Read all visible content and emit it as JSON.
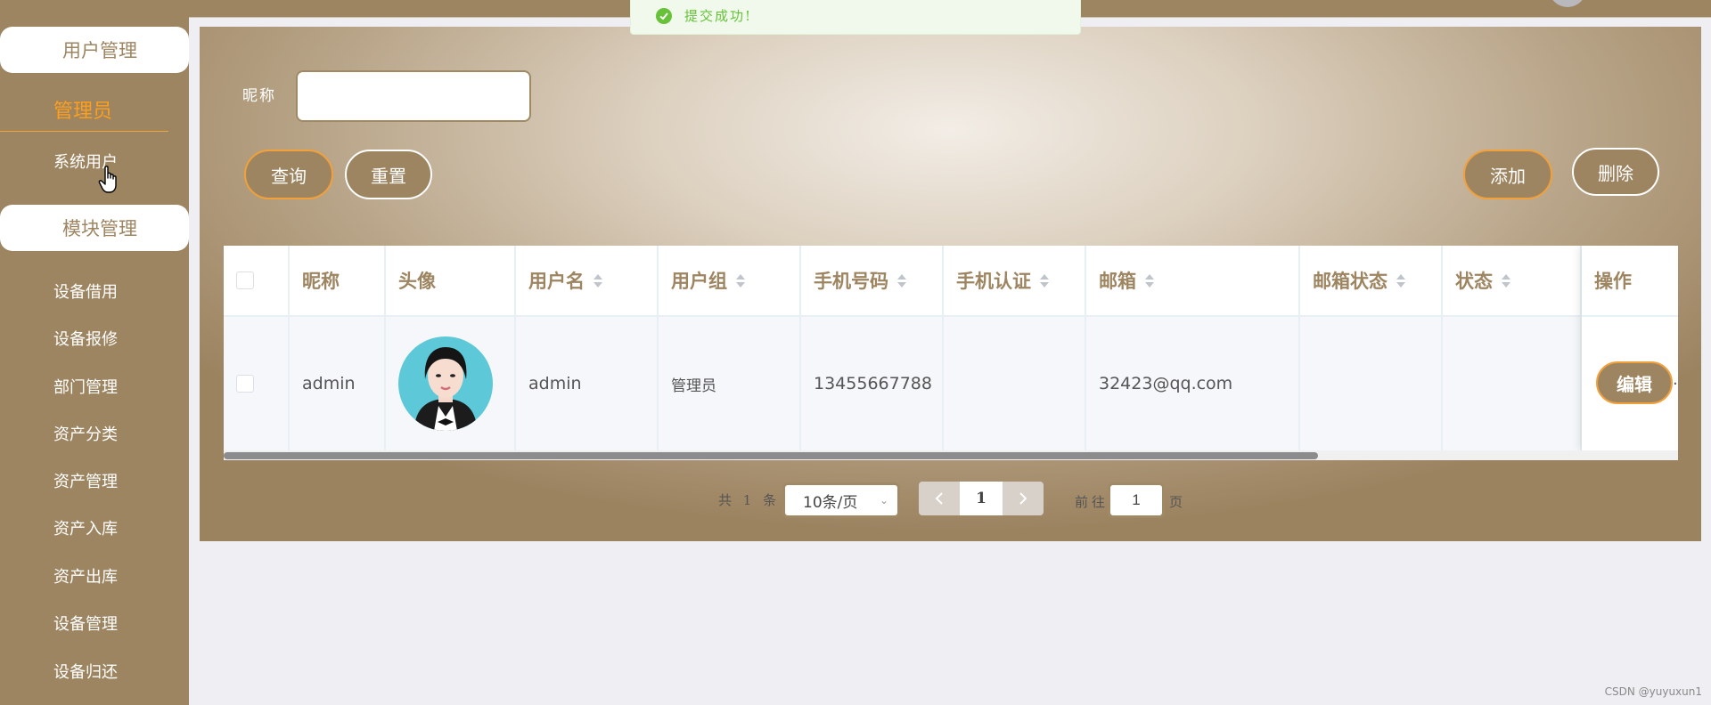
{
  "toast": {
    "message": "提交成功!"
  },
  "sidebar": {
    "group1": "用户管理",
    "role": "管理员",
    "group1_items": [
      "系统用户"
    ],
    "group2": "模块管理",
    "group2_items": [
      "设备借用",
      "设备报修",
      "部门管理",
      "资产分类",
      "资产管理",
      "资产入库",
      "资产出库",
      "设备管理",
      "设备归还"
    ]
  },
  "search": {
    "label": "昵称",
    "value": "",
    "placeholder": ""
  },
  "buttons": {
    "query": "查询",
    "reset": "重置",
    "add": "添加",
    "delete": "删除",
    "edit": "编辑"
  },
  "table": {
    "columns": [
      "昵称",
      "头像",
      "用户名",
      "用户组",
      "手机号码",
      "手机认证",
      "邮箱",
      "邮箱状态",
      "状态",
      "操作"
    ],
    "sortable": [
      false,
      false,
      true,
      true,
      true,
      true,
      true,
      true,
      true,
      false
    ],
    "rows": [
      {
        "nickname": "admin",
        "username": "admin",
        "group": "管理员",
        "phone": "13455667788",
        "phone_verified": "",
        "email": "32423@qq.com",
        "email_status": "",
        "status": ""
      }
    ],
    "overflow_marker": "."
  },
  "pagination": {
    "total": "共 1 条",
    "page_size": "10条/页",
    "current_page": "1",
    "goto_label": "前往",
    "goto_value": "1",
    "goto_suffix": "页"
  },
  "watermark": "CSDN @yuyuxun1",
  "colors": {
    "brand": "#9e8561",
    "accent": "#f2a03a",
    "role_title": "#ff9e1b",
    "success": "#67c23a"
  }
}
